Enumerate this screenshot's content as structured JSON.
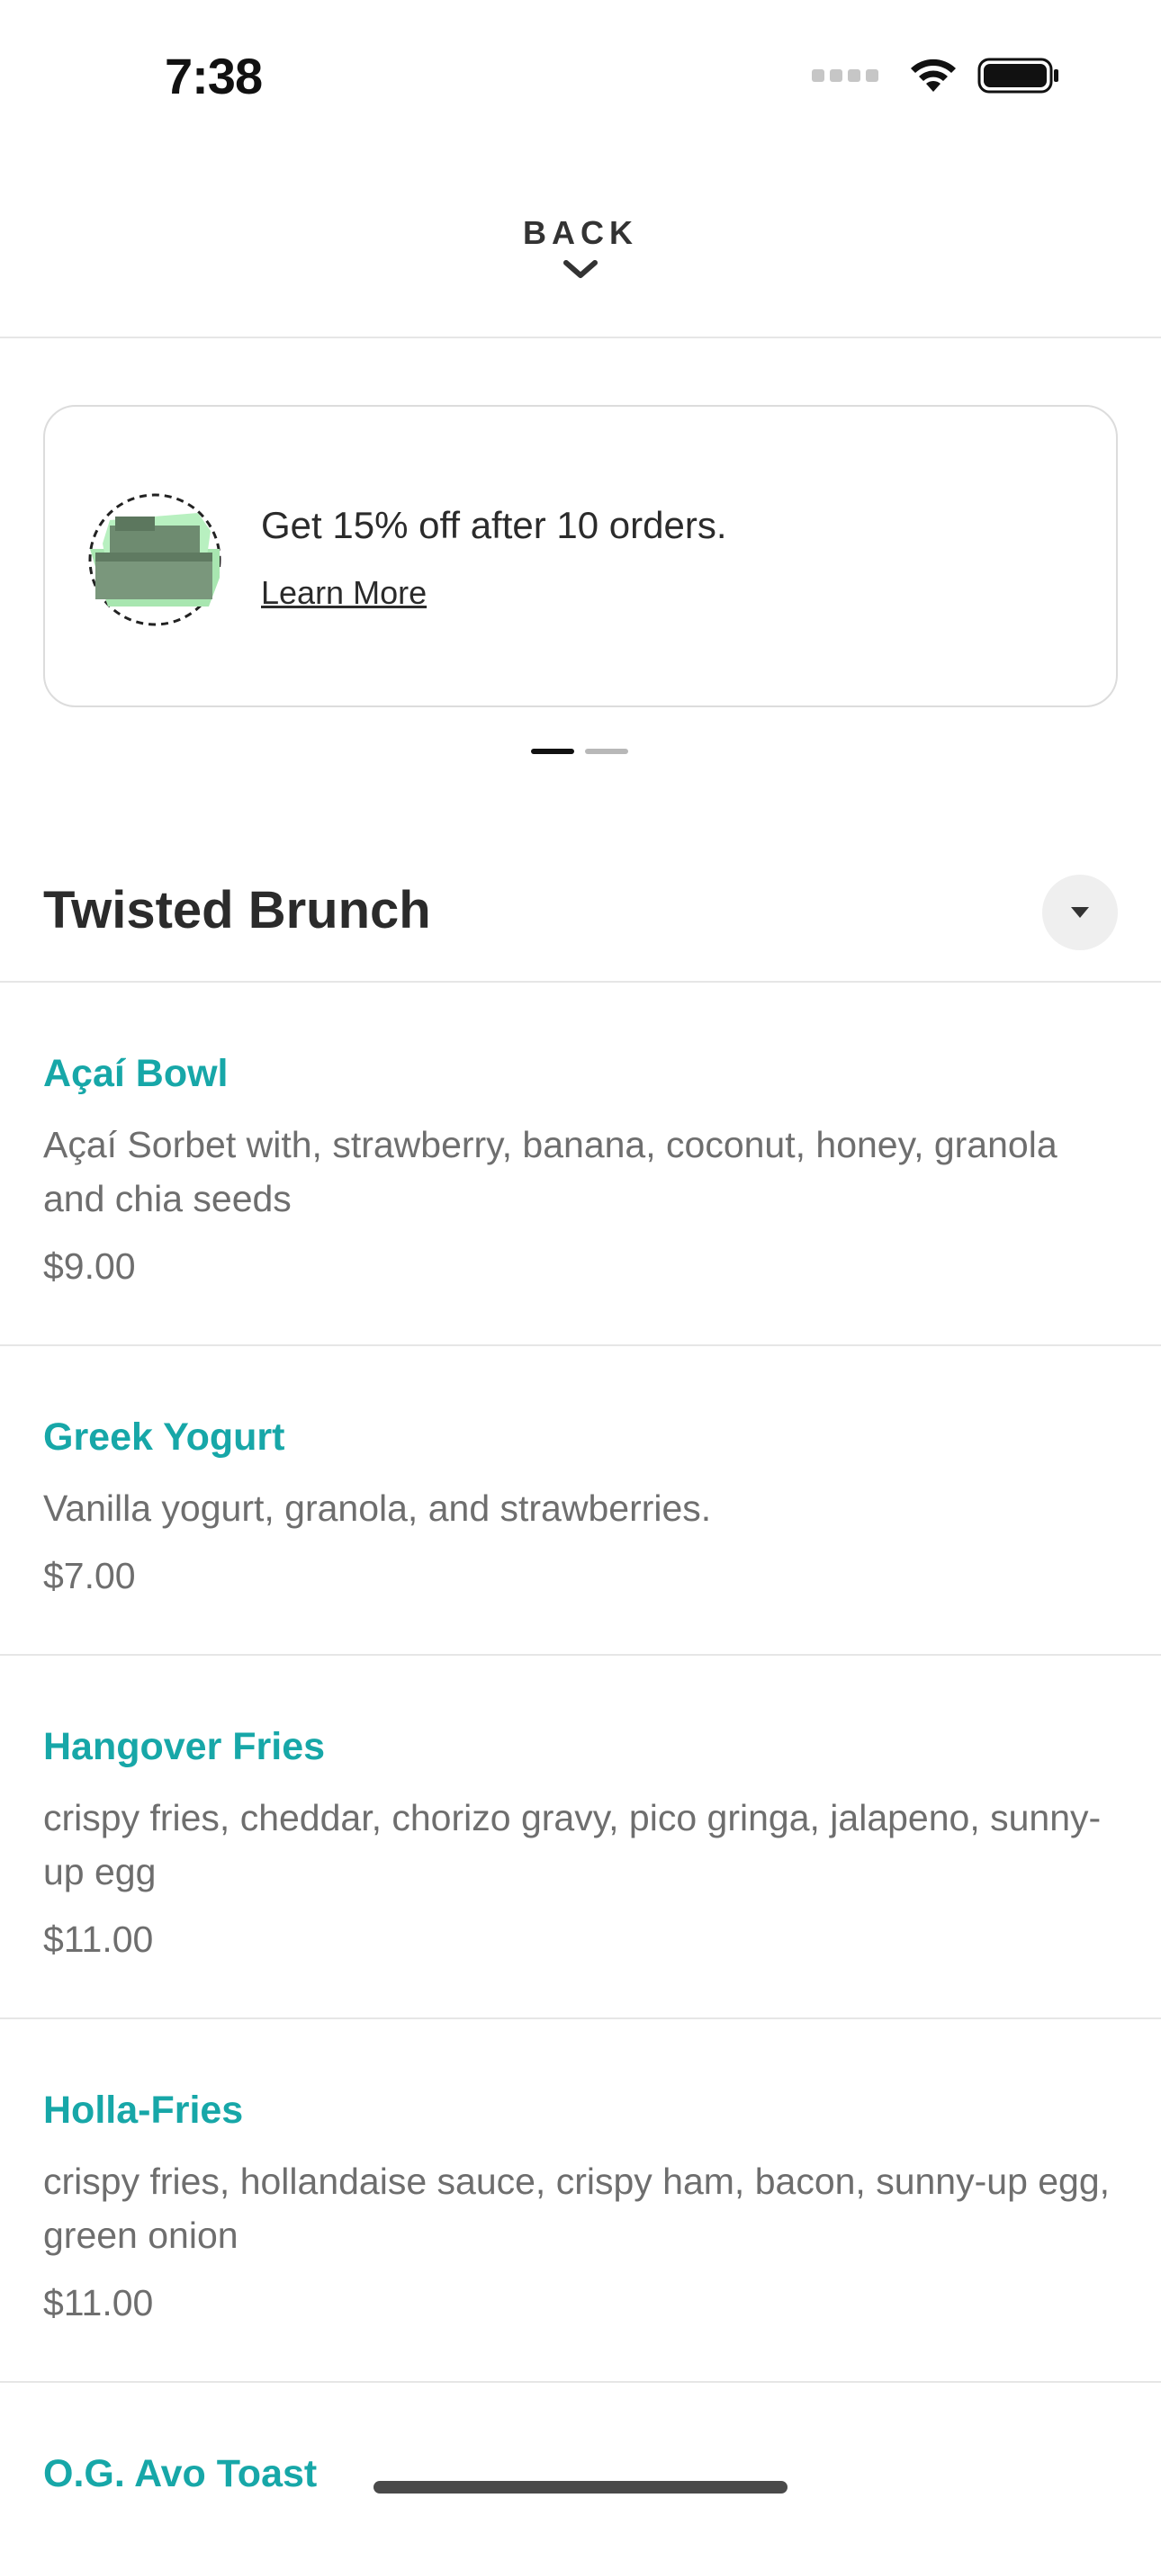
{
  "status_bar": {
    "time": "7:38"
  },
  "header": {
    "back_label": "BACK"
  },
  "promo": {
    "text": "Get 15% off after 10 orders.",
    "link_label": "Learn More",
    "pages_total": 2,
    "active_page": 1
  },
  "section": {
    "title": "Twisted Brunch"
  },
  "menu": {
    "items": [
      {
        "name": "Açaí Bowl",
        "description": "Açaí Sorbet with, strawberry, banana, coconut, honey, granola and chia seeds",
        "price": "$9.00"
      },
      {
        "name": "Greek Yogurt",
        "description": "Vanilla yogurt, granola, and strawberries.",
        "price": "$7.00"
      },
      {
        "name": "Hangover Fries",
        "description": "crispy fries, cheddar, chorizo gravy, pico gringa, jalapeno, sunny-up egg",
        "price": "$11.00"
      },
      {
        "name": "Holla-Fries",
        "description": "crispy fries, hollandaise sauce, crispy ham, bacon, sunny-up egg, green onion",
        "price": "$11.00"
      },
      {
        "name": "O.G. Avo Toast",
        "description": "",
        "price": ""
      }
    ]
  },
  "colors": {
    "accent": "#17a7a8",
    "text_primary": "#2b2b2b",
    "text_secondary": "#6e6e6e",
    "divider": "#e6e6e6"
  }
}
